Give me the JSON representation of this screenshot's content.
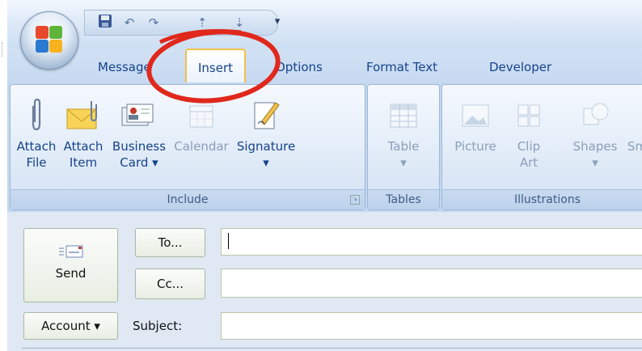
{
  "quick_access": {
    "save_icon": "save-icon",
    "undo_icon": "undo-icon",
    "redo_icon": "redo-icon",
    "up_icon": "arrow-up-icon",
    "down_icon": "arrow-down-icon",
    "customize_icon": "customize-qat-icon"
  },
  "tabs": [
    "Message",
    "Insert",
    "Options",
    "Format Text",
    "Developer"
  ],
  "active_tab": "Insert",
  "ribbon": {
    "include": {
      "label": "Include",
      "buttons": [
        {
          "label": "Attach\nFile",
          "icon": "paperclip-icon"
        },
        {
          "label": "Attach\nItem",
          "icon": "envelope-clip-icon"
        },
        {
          "label": "Business\nCard ▾",
          "icon": "business-card-icon"
        },
        {
          "label": "Calendar",
          "icon": "calendar-icon"
        },
        {
          "label": "Signature\n▾",
          "icon": "signature-icon"
        }
      ]
    },
    "tables": {
      "label": "Tables",
      "buttons": [
        {
          "label": "Table\n▾",
          "icon": "table-icon"
        }
      ]
    },
    "illustrations": {
      "label": "Illustrations",
      "buttons": [
        {
          "label": "Picture",
          "icon": "picture-icon"
        },
        {
          "label": "Clip\nArt",
          "icon": "clip-art-icon"
        },
        {
          "label": "Shapes\n▾",
          "icon": "shapes-icon"
        },
        {
          "label": "Sm",
          "icon": "smartart-icon"
        }
      ]
    }
  },
  "compose": {
    "send_label": "Send",
    "to_label": "To...",
    "cc_label": "Cc...",
    "account_label": "Account ▾",
    "subject_label": "Subject:",
    "to_value": "",
    "cc_value": "",
    "subject_value": ""
  },
  "colors": {
    "ribbon_bg": "#c3d7ef",
    "tab_text": "#15428b",
    "annotation": "#e0281c"
  }
}
